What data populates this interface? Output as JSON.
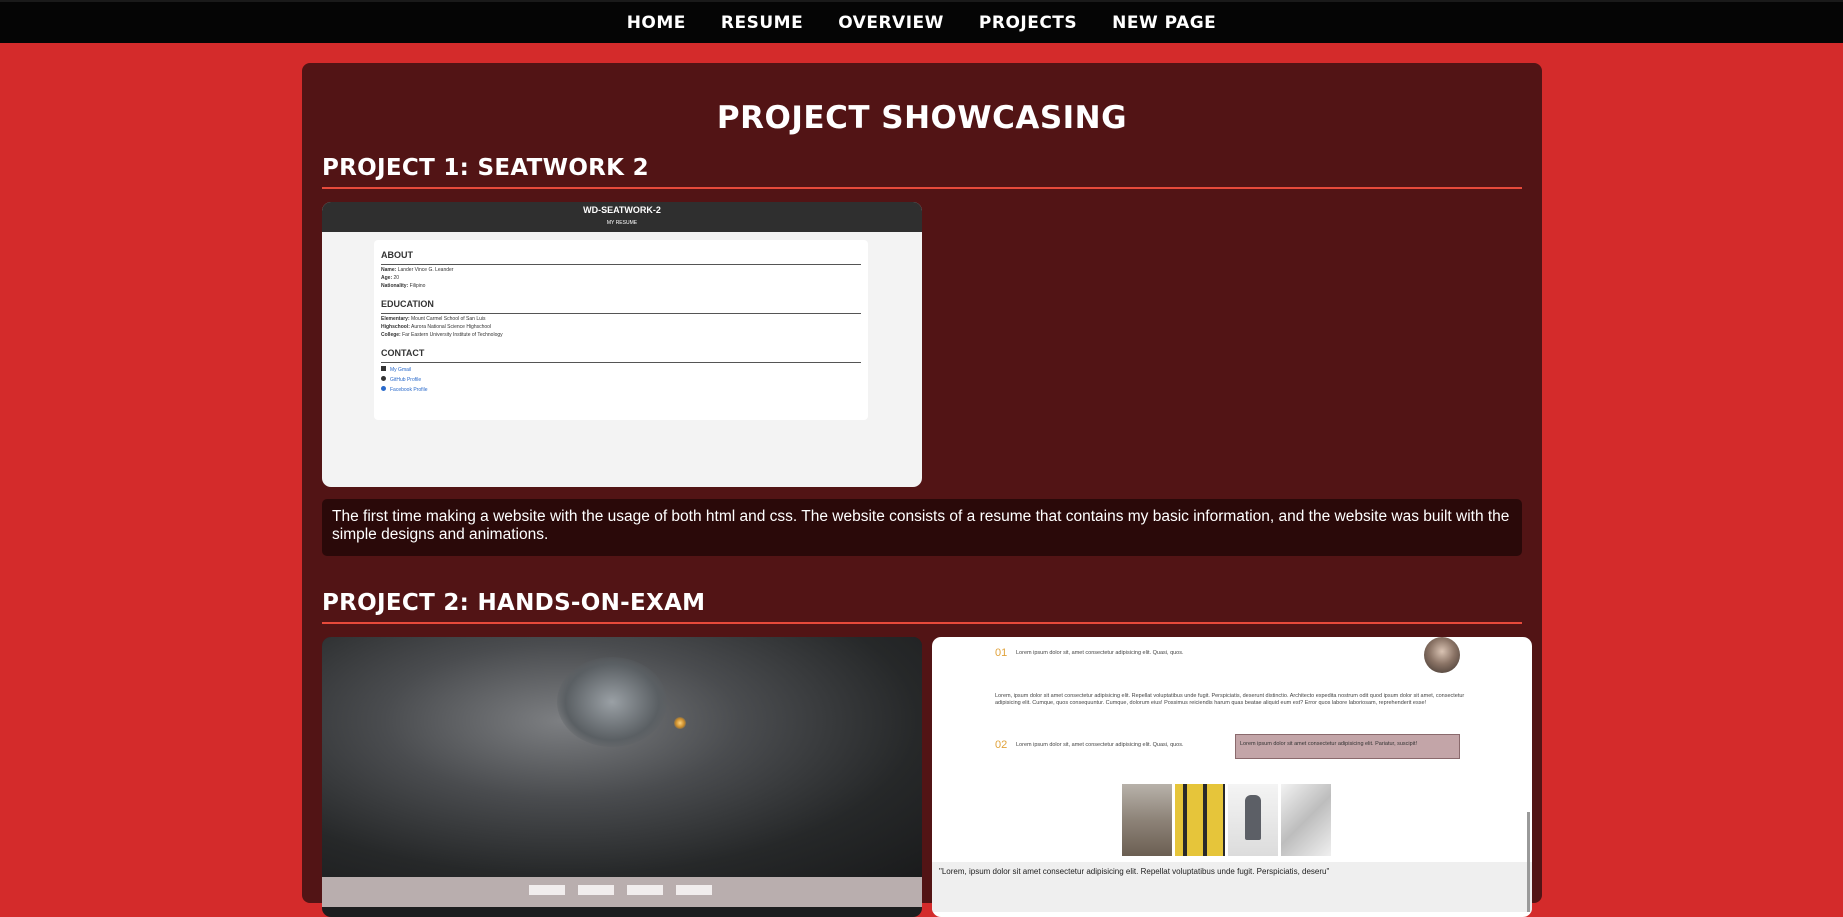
{
  "nav": {
    "links": [
      "HOME",
      "RESUME",
      "OVERVIEW",
      "PROJECTS",
      "NEW PAGE"
    ]
  },
  "page": {
    "title": "PROJECT SHOWCASING"
  },
  "projects": [
    {
      "heading": "PROJECT 1: SEATWORK 2",
      "preview": {
        "title": "WD-SEATWORK-2",
        "subtitle": "MY RESUME",
        "about_heading": "ABOUT",
        "about": [
          {
            "label": "Name:",
            "value": "Lander Vince G. Leander"
          },
          {
            "label": "Age:",
            "value": "20"
          },
          {
            "label": "Nationality:",
            "value": "Filipino"
          }
        ],
        "education_heading": "EDUCATION",
        "education": [
          {
            "label": "Elementary:",
            "value": "Mount Carmel School of San Luis"
          },
          {
            "label": "Highschool:",
            "value": "Aurora National Science Highschool"
          },
          {
            "label": "College:",
            "value": "Far Eastern University Institute of Technology"
          }
        ],
        "contact_heading": "CONTACT",
        "contact": [
          "My Gmail",
          "GitHub Profile",
          "Facebook Profile"
        ]
      },
      "description": "The first time making a website with the usage of both html and css. The website consists of a resume that contains my basic information, and the website was built with the simple designs and animations."
    },
    {
      "heading": "PROJECT 2: HANDS-ON-EXAM",
      "preview2": {
        "num1": "01",
        "line1": "Lorem ipsum dolor sit, amet consectetur adipisicing elit. Quasi, quos.",
        "para": "Lorem, ipsum dolor sit amet consectetur adipisicing elit. Repellat voluptatibus unde fugit. Perspiciatis, deserunt distinctio. Architecto expedita nostrum odit quod ipsum dolor sit amet, consectetur adipisicing elit. Cumque, quos consequuntur. Cumque, dolorum eius! Possimus reiciendis harum quas beatae aliquid eum est? Error quos labore laboriosam, reprehenderit esse!",
        "num2": "02",
        "line2": "Lorem ipsum dolor sit, amet consectetur adipisicing elit. Quasi, quos.",
        "box": "Lorem ipsum dolor sit amet consectetur adipisicing elit. Pariatur, suscipit!",
        "quote": "\"Lorem, ipsum dolor sit amet consectetur adipisicing elit. Repellat voluptatibus unde fugit. Perspiciatis, deseru\""
      }
    }
  ]
}
